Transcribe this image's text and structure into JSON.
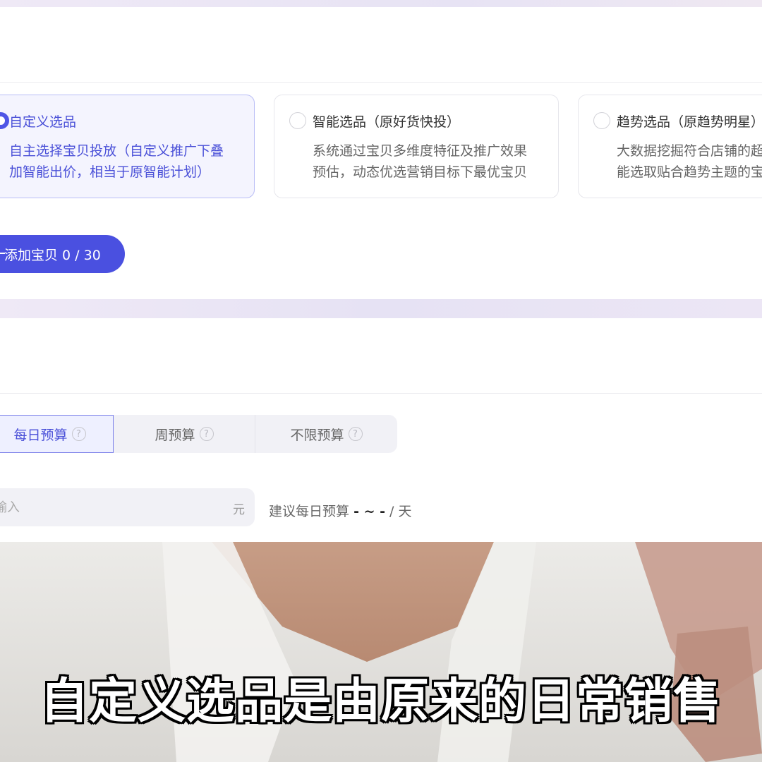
{
  "product_selection": {
    "options": [
      {
        "title": "自定义选品",
        "desc_line1": "自主选择宝贝投放（自定义推广下叠",
        "desc_line2": "加智能出价，相当于原智能计划）",
        "selected": true
      },
      {
        "title": "智能选品（原好货快投）",
        "desc_line1": "系统通过宝贝多维度特征及推广效果",
        "desc_line2": "预估，动态优选营销目标下最优宝贝",
        "selected": false
      },
      {
        "title": "趋势选品（原趋势明星）",
        "desc_line1": "大数据挖掘符合店铺的超",
        "desc_line2": "能选取贴合趋势主题的宝",
        "selected": false
      }
    ],
    "add_button_label": "添加宝贝 0 / 30"
  },
  "budget": {
    "tabs": [
      {
        "label": "每日预算",
        "help": "?",
        "active": true
      },
      {
        "label": "周预算",
        "help": "?",
        "active": false
      },
      {
        "label": "不限预算",
        "help": "?",
        "active": false
      }
    ],
    "input_placeholder": "输入",
    "unit": "元",
    "suggest_prefix": "建议每日预算",
    "suggest_value": "- ~ -",
    "suggest_suffix": "/ 天"
  },
  "video": {
    "subtitle": "自定义选品是由原来的日常销售"
  },
  "colors": {
    "accent": "#4a50e0",
    "selected_bg": "#f4f4fe"
  }
}
